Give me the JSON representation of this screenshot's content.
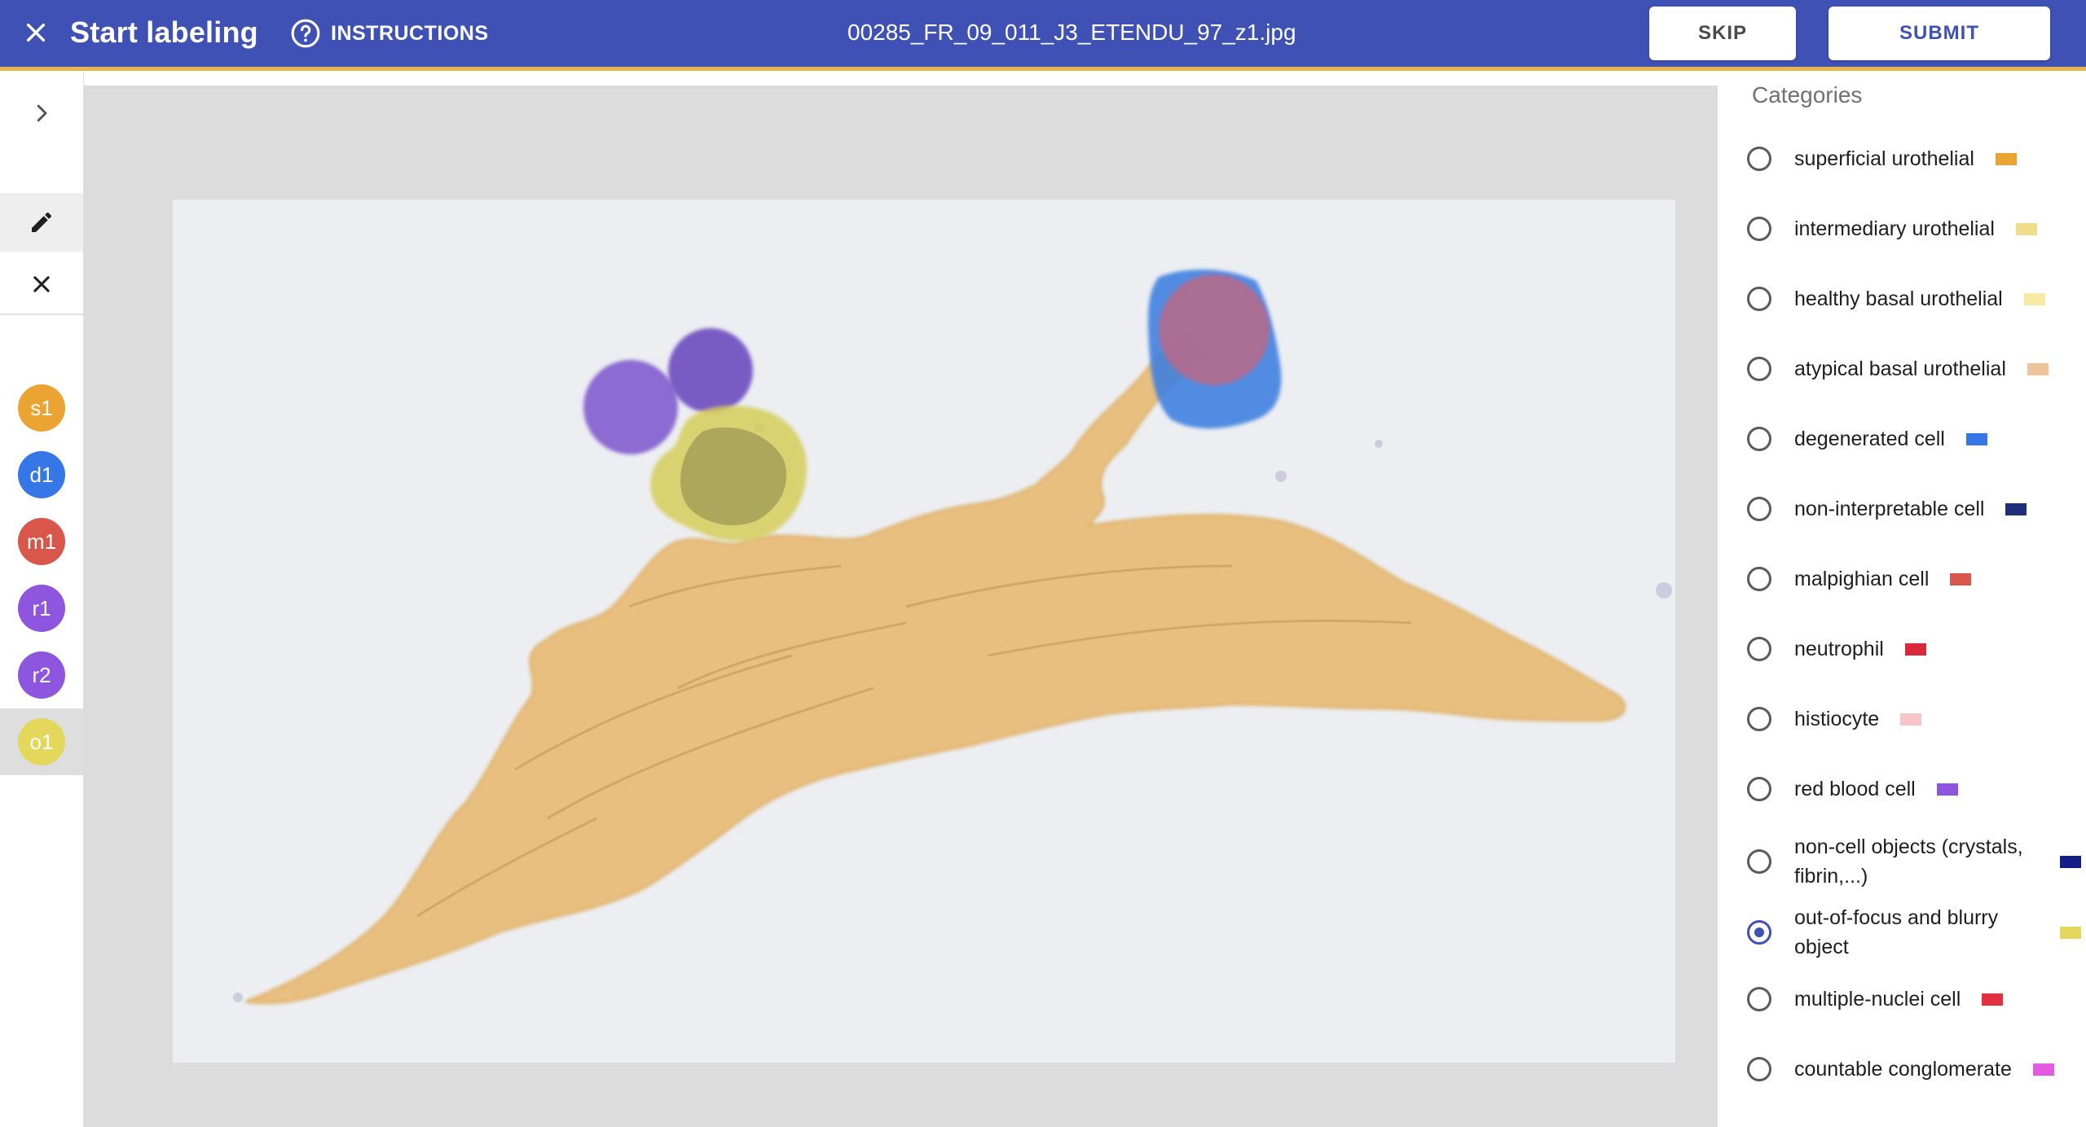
{
  "header": {
    "close_icon": "close-icon",
    "title": "Start labeling",
    "instructions_icon": "help-circle-icon",
    "instructions_label": "INSTRUCTIONS",
    "filename": "00285_FR_09_011_J3_ETENDU_97_z1.jpg",
    "skip_label": "SKIP",
    "submit_label": "SUBMIT",
    "bar_color": "#3f51b5",
    "accent_line_color": "#e6b54a"
  },
  "toolbar": {
    "expand_icon": "chevron-right-icon",
    "draw_icon": "pencil-icon",
    "clear_icon": "close-icon",
    "labels": [
      {
        "text": "s1",
        "color": "#eba432",
        "active": false
      },
      {
        "text": "d1",
        "color": "#3577e6",
        "active": false
      },
      {
        "text": "m1",
        "color": "#d9574a",
        "active": false
      },
      {
        "text": "r1",
        "color": "#8e55de",
        "active": false
      },
      {
        "text": "r2",
        "color": "#8e55de",
        "active": false
      },
      {
        "text": "o1",
        "color": "#e3d85b",
        "active": true
      }
    ]
  },
  "categories_panel": {
    "title": "Categories",
    "items": [
      {
        "label": "superficial urothelial",
        "color": "#eba432",
        "selected": false
      },
      {
        "label": "intermediary urothelial",
        "color": "#f0dc8c",
        "selected": false
      },
      {
        "label": "healthy basal urothelial",
        "color": "#f7eaa3",
        "selected": false
      },
      {
        "label": "atypical basal urothelial",
        "color": "#f0c49b",
        "selected": false
      },
      {
        "label": "degenerated cell",
        "color": "#3577e6",
        "selected": false
      },
      {
        "label": "non-interpretable cell",
        "color": "#1f2f7a",
        "selected": false
      },
      {
        "label": "malpighian cell",
        "color": "#d9574a",
        "selected": false
      },
      {
        "label": "neutrophil",
        "color": "#d92839",
        "selected": false
      },
      {
        "label": "histiocyte",
        "color": "#f6c6c9",
        "selected": false
      },
      {
        "label": "red blood cell",
        "color": "#8e55de",
        "selected": false
      },
      {
        "label": "non-cell objects (crystals, fibrin,...)",
        "color": "#141e86",
        "selected": false
      },
      {
        "label": "out-of-focus and blurry object",
        "color": "#e3d85b",
        "selected": true
      },
      {
        "label": "multiple-nuclei cell",
        "color": "#e23040",
        "selected": false
      },
      {
        "label": "countable conglomerate",
        "color": "#e35be3",
        "selected": false
      }
    ]
  }
}
